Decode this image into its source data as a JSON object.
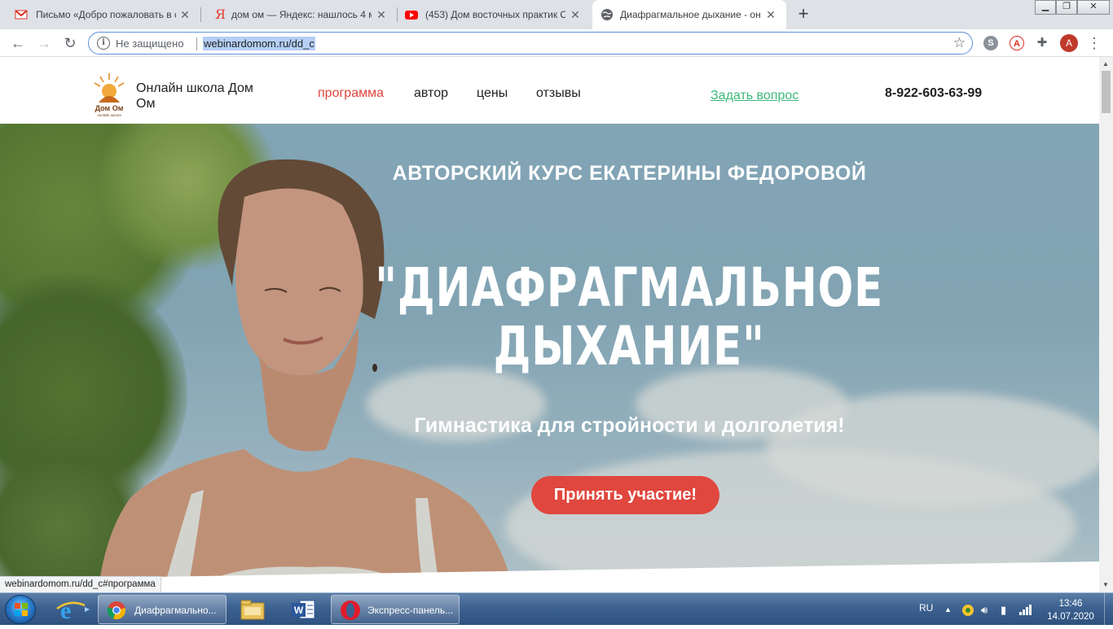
{
  "browser": {
    "tabs": [
      {
        "title": "Письмо «Добро пожаловать в с",
        "icon": "gmail-icon",
        "active": false
      },
      {
        "title": "дом ом — Яндекс: нашлось 4 м",
        "icon": "yandex-icon",
        "active": false
      },
      {
        "title": "(453) Дом восточных практик О",
        "icon": "youtube-icon",
        "active": false
      },
      {
        "title": "Диафрагмальное дыхание - онл",
        "icon": "globe-icon",
        "active": true
      }
    ],
    "new_tab": "+",
    "omnibox": {
      "security_label": "Не защищено",
      "url": "webinardomom.ru/dd_c"
    },
    "avatar_letter": "A",
    "status_url": "webinardomom.ru/dd_c#программа"
  },
  "site": {
    "school_name": "Онлайн школа Дом Ом",
    "logo_text": "Дом Ом",
    "logo_subtext": "онлайн школа",
    "nav": [
      {
        "label": "программа",
        "active": true
      },
      {
        "label": "автор",
        "active": false
      },
      {
        "label": "цены",
        "active": false
      },
      {
        "label": "отзывы",
        "active": false
      }
    ],
    "ask_question": "Задать вопрос",
    "phone": "8-922-603-63-99",
    "hero": {
      "kicker": "АВТОРСКИЙ КУРС ЕКАТЕРИНЫ ФЕДОРОВОЙ",
      "title_line1": "\"ДИАФРАГМАЛЬНОЕ",
      "title_line2": "ДЫХАНИЕ\"",
      "subtitle": "Гимнастика для стройности и долголетия!",
      "cta": "Принять участие!"
    },
    "colors": {
      "accent_red": "#e0473e",
      "link_green": "#3db87a"
    }
  },
  "taskbar": {
    "buttons": [
      {
        "label": "Диафрагмально...",
        "icon": "chrome-icon"
      },
      {
        "label": "Экспресс-панель...",
        "icon": "opera-icon"
      }
    ],
    "language": "RU",
    "time": "13:46",
    "date": "14.07.2020"
  }
}
